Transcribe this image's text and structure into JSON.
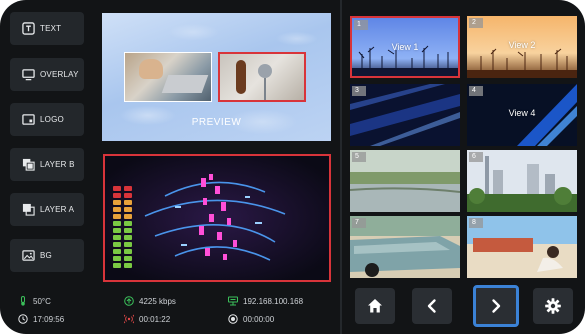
{
  "layers": [
    {
      "label": "TEXT",
      "icon": "text-icon"
    },
    {
      "label": "OVERLAY",
      "icon": "monitor-icon"
    },
    {
      "label": "LOGO",
      "icon": "logo-icon"
    },
    {
      "label": "LAYER B",
      "icon": "layer-b-icon"
    },
    {
      "label": "LAYER A",
      "icon": "layer-a-icon"
    },
    {
      "label": "BG",
      "icon": "image-icon"
    }
  ],
  "preview": {
    "label": "PREVIEW"
  },
  "status": {
    "temperature": "50°C",
    "bitrate": "4225 kbps",
    "ip_address": "192.168.100.168",
    "clock": "17:09:56",
    "stream_time": "00:01:22",
    "record_time": "00:00:00"
  },
  "sources": [
    {
      "number": "1",
      "label": "View 1"
    },
    {
      "number": "2",
      "label": "View 2"
    },
    {
      "number": "3",
      "label": ""
    },
    {
      "number": "4",
      "label": "View 4"
    },
    {
      "number": "5",
      "label": ""
    },
    {
      "number": "6",
      "label": ""
    },
    {
      "number": "7",
      "label": ""
    },
    {
      "number": "8",
      "label": ""
    }
  ],
  "nav": {
    "home": "home-icon",
    "previous": "chevron-left-icon",
    "next": "chevron-right-icon",
    "settings": "gear-icon"
  },
  "colors": {
    "background": "#121416",
    "panel_button": "#23272b",
    "program_tally": "#d8343a",
    "focus": "#3b82d6",
    "status_icon_green": "#3bbf5a",
    "status_icon_red": "#e04848"
  }
}
